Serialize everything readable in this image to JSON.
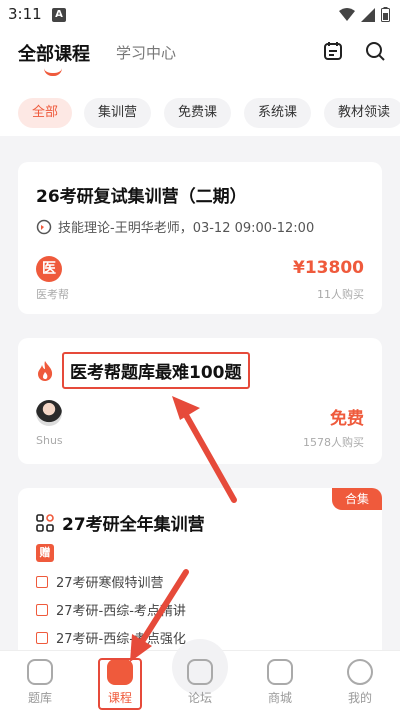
{
  "status": {
    "time": "3:11",
    "notif_letter": "A"
  },
  "topnav": {
    "tabs": [
      {
        "label": "全部课程",
        "active": true
      },
      {
        "label": "学习中心",
        "active": false
      }
    ]
  },
  "chips": [
    "全部",
    "集训营",
    "免费课",
    "系统课",
    "教材领读"
  ],
  "cards": [
    {
      "title": "26考研复试集训营（二期）",
      "schedule": "技能理论-王明华老师，03-12 09:00-12:00",
      "logo_text": "医",
      "brand": "医考帮",
      "price": "¥13800",
      "buyers": "11人购买"
    },
    {
      "title": "医考帮题库最难100题",
      "author": "Shus",
      "price": "免费",
      "buyers": "1578人购买"
    },
    {
      "badge": "合集",
      "title": "27考研全年集训营",
      "gift": "赠",
      "items": [
        "27考研寒假特训营",
        "27考研-西综-考点精讲",
        "27考研-西综-考点强化"
      ]
    }
  ],
  "bottomnav": [
    {
      "label": "题库",
      "icon": "question-bank-icon"
    },
    {
      "label": "课程",
      "icon": "course-icon",
      "active": true
    },
    {
      "label": "论坛",
      "icon": "forum-icon"
    },
    {
      "label": "商城",
      "icon": "shop-icon"
    },
    {
      "label": "我的",
      "icon": "profile-icon"
    }
  ],
  "colors": {
    "accent": "#ef5a3c",
    "highlight": "#e64a3a"
  }
}
